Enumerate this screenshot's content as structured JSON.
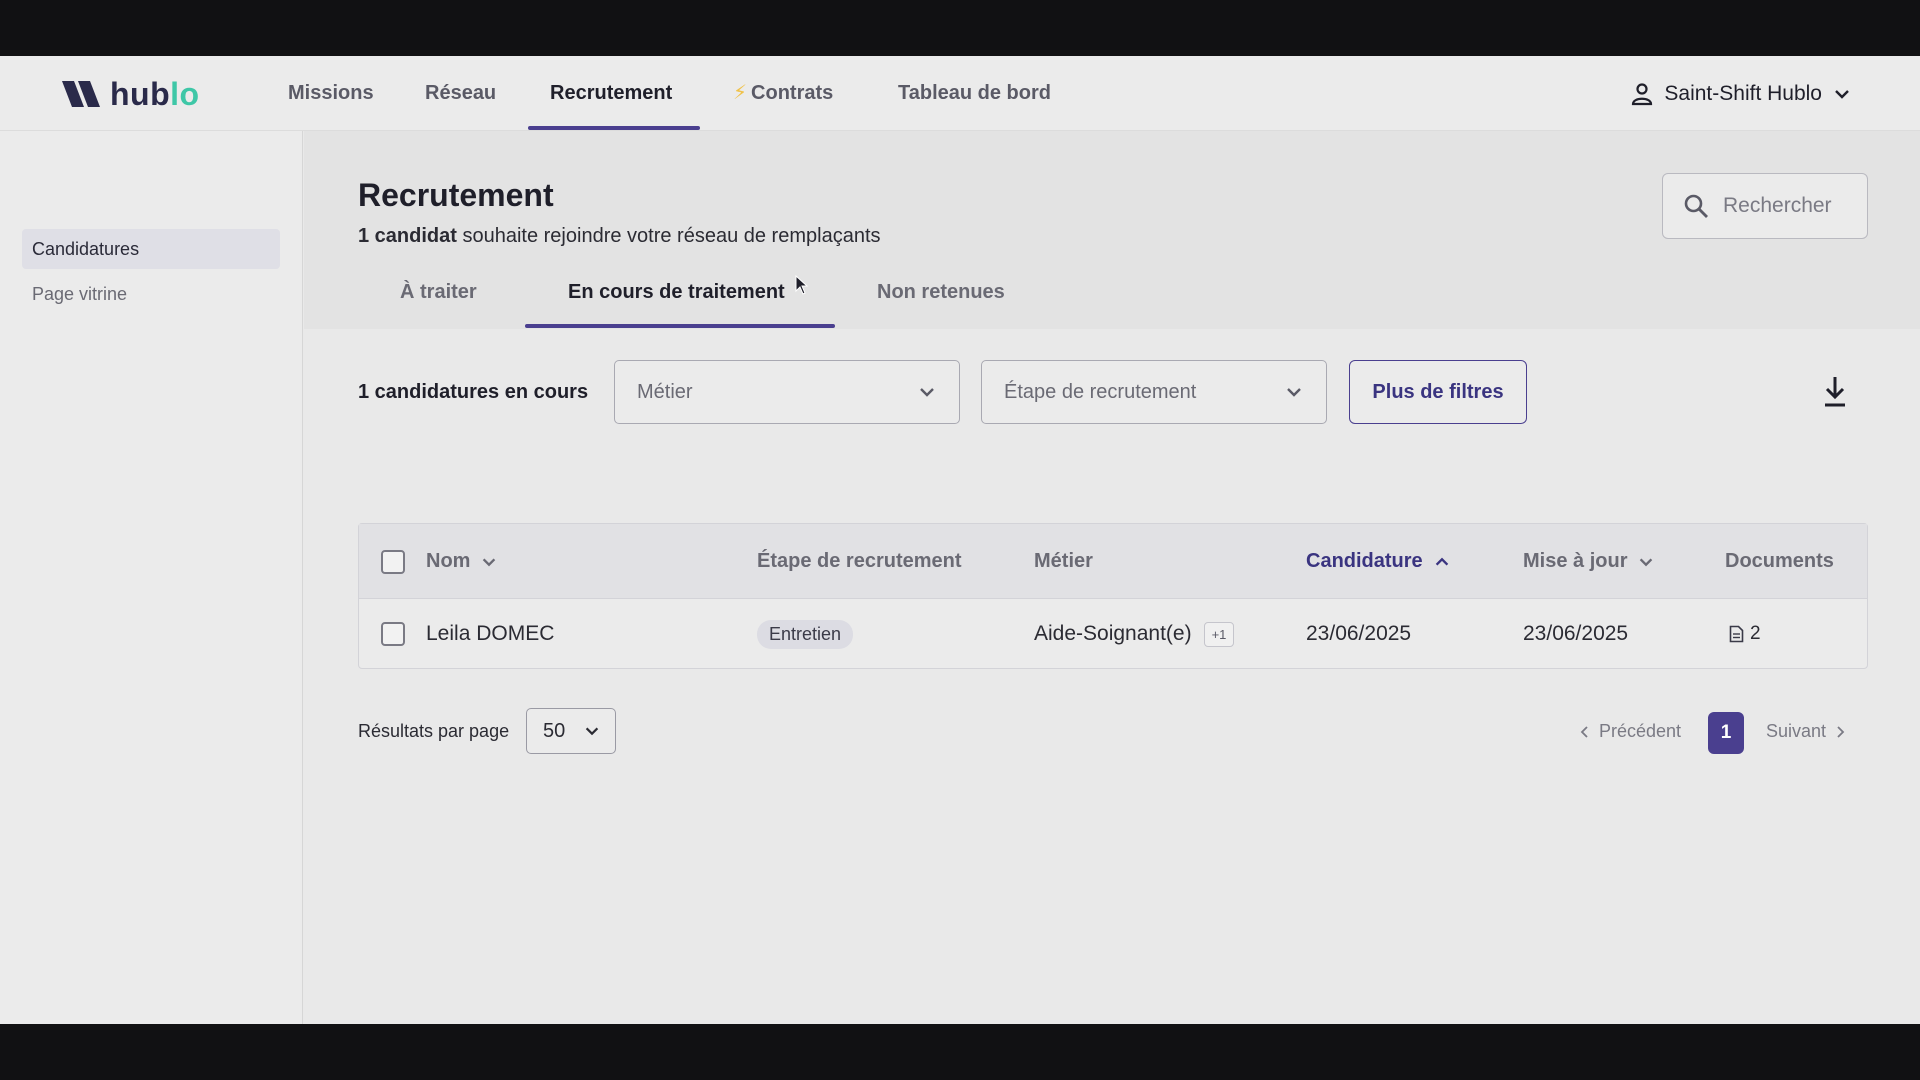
{
  "brand": {
    "name_part1": "hub",
    "name_part2": "lo",
    "primary": "#4a3f8f",
    "accent": "#3ec7a7"
  },
  "nav": {
    "items": [
      {
        "label": "Missions"
      },
      {
        "label": "Réseau"
      },
      {
        "label": "Recrutement"
      },
      {
        "label": "Contrats"
      },
      {
        "label": "Tableau de bord"
      }
    ],
    "active": "Recrutement",
    "contracts_icon": "lightning-icon"
  },
  "user": {
    "name": "Saint-Shift Hublo",
    "icon": "user-icon"
  },
  "sidebar": {
    "items": [
      {
        "label": "Candidatures"
      },
      {
        "label": "Page vitrine"
      }
    ],
    "active": "Candidatures"
  },
  "page": {
    "title": "Recrutement",
    "subtitle_bold": "1 candidat",
    "subtitle_rest": " souhaite rejoindre votre réseau de remplaçants"
  },
  "search": {
    "placeholder": "Rechercher"
  },
  "tabs": [
    {
      "label": "À traiter"
    },
    {
      "label": "En cours de traitement"
    },
    {
      "label": "Non retenues"
    }
  ],
  "active_tab": "En cours de traitement",
  "filters": {
    "count_label": "1 candidatures en cours",
    "metier": "Métier",
    "etape": "Étape de recrutement",
    "more": "Plus de filtres"
  },
  "table": {
    "headers": {
      "nom": "Nom",
      "etape": "Étape de recrutement",
      "metier": "Métier",
      "candidature": "Candidature",
      "mise_a_jour": "Mise à jour",
      "documents": "Documents"
    },
    "rows": [
      {
        "nom": "Leila DOMEC",
        "etape": "Entretien",
        "metier": "Aide-Soignant(e)",
        "metier_extra": "+1",
        "candidature": "23/06/2025",
        "mise_a_jour": "23/06/2025",
        "documents": "2"
      }
    ]
  },
  "pagination": {
    "per_page_label": "Résultats par page",
    "per_page": "50",
    "prev": "Précédent",
    "current": "1",
    "next": "Suivant"
  }
}
